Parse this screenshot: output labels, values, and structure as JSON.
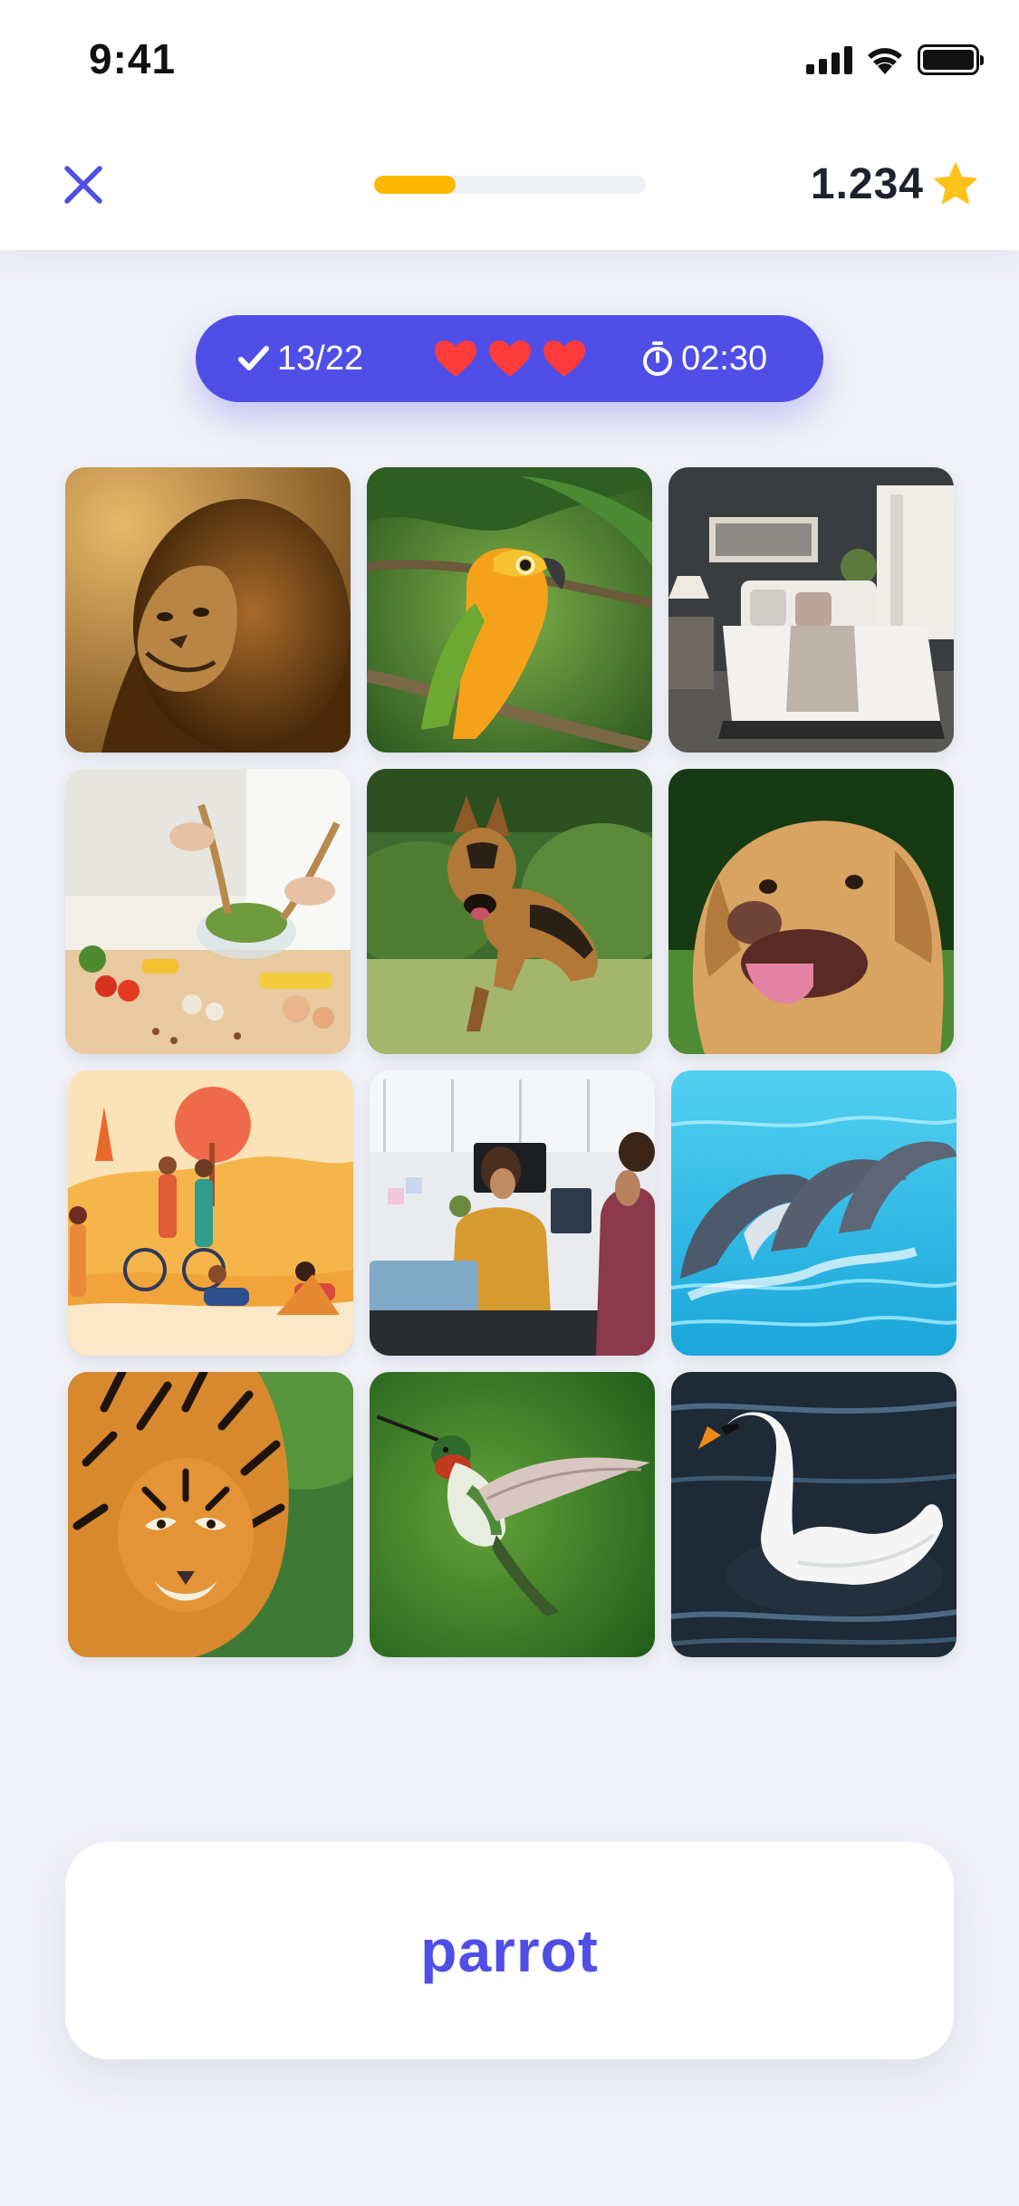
{
  "status_bar": {
    "time": "9:41"
  },
  "header": {
    "progress_fraction": 0.3,
    "score": "1.234"
  },
  "stats": {
    "correct": "13/22",
    "lives": 3,
    "timer": "02:30"
  },
  "grid": {
    "tiles": [
      {
        "subject": "lion"
      },
      {
        "subject": "parrot"
      },
      {
        "subject": "bedroom"
      },
      {
        "subject": "cooking"
      },
      {
        "subject": "german-shepherd"
      },
      {
        "subject": "golden-retriever"
      },
      {
        "subject": "illustration"
      },
      {
        "subject": "office"
      },
      {
        "subject": "dolphins"
      },
      {
        "subject": "tiger"
      },
      {
        "subject": "hummingbird"
      },
      {
        "subject": "swan"
      }
    ]
  },
  "answer": {
    "word": "parrot"
  },
  "colors": {
    "accent": "#4F4EE6",
    "progress": "#FFB800",
    "heart": "#FF3B3B",
    "star": "#FFC21A",
    "background": "#F1F2F8"
  }
}
